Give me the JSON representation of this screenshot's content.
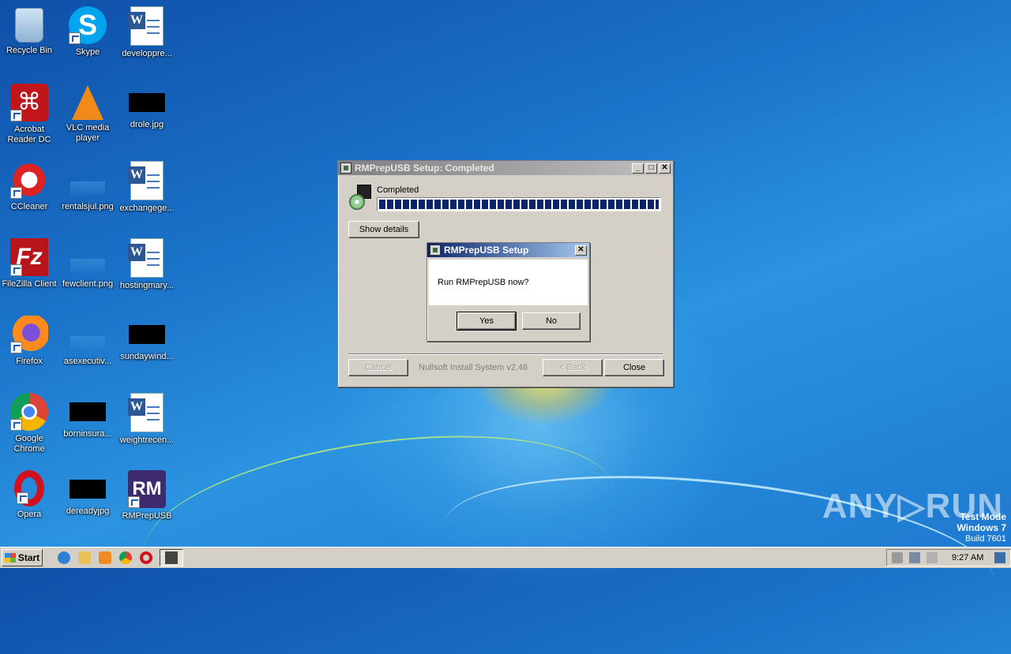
{
  "desktop": {
    "icons": [
      {
        "label": "Recycle Bin"
      },
      {
        "label": "Skype"
      },
      {
        "label": "developpre..."
      },
      {
        "label": "Acrobat Reader DC"
      },
      {
        "label": "VLC media player"
      },
      {
        "label": "drole.jpg"
      },
      {
        "label": "CCleaner"
      },
      {
        "label": "rentalsjul.png"
      },
      {
        "label": "exchangege..."
      },
      {
        "label": "FileZilla Client"
      },
      {
        "label": "fewclient.png"
      },
      {
        "label": "hostingmary..."
      },
      {
        "label": "Firefox"
      },
      {
        "label": "asexecutiv..."
      },
      {
        "label": "sundaywind..."
      },
      {
        "label": "Google Chrome"
      },
      {
        "label": "borninsura..."
      },
      {
        "label": "weightrecen..."
      },
      {
        "label": "Opera"
      },
      {
        "label": "dereadyjpg"
      },
      {
        "label": "RMPrepUSB"
      }
    ]
  },
  "setup_window": {
    "title": "RMPrepUSB Setup: Completed",
    "status": "Completed",
    "progress": 1.0,
    "show_details": "Show details",
    "cancel": "Cancel",
    "branding": "Nullsoft Install System v2.46",
    "back": "< Back",
    "close": "Close",
    "minimize_glyph": "_",
    "maximize_glyph": "□",
    "close_glyph": "✕"
  },
  "dialog": {
    "title": "RMPrepUSB Setup",
    "message": "Run RMPrepUSB now?",
    "yes": "Yes",
    "no": "No",
    "close_glyph": "✕"
  },
  "taskbar": {
    "start": "Start",
    "clock": "9:27 AM"
  },
  "watermark": "ANY▷RUN",
  "test_mode": {
    "line1": "Test Mode",
    "line2": "Windows 7",
    "line3": "Build 7601"
  }
}
